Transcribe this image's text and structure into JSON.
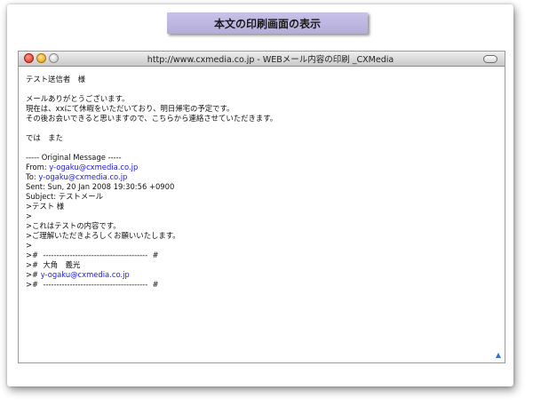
{
  "banner": {
    "title": "本文の印刷画面の表示"
  },
  "window": {
    "title": "http://www.cxmedia.co.jp - WEBメール内容の印刷 _CXMedia"
  },
  "email": {
    "greeting": "テスト送信者　様",
    "body_1": "メールありがとうございます。",
    "body_2": "現在は、xxにて休暇をいただいており、明日帰宅の予定です。",
    "body_3": "その後お会いできると思いますので、こちらから連絡させていただきます。",
    "closing": "では　また",
    "original_header": "----- Original Message -----",
    "from_label": "From: ",
    "from_addr": "y-ogaku@cxmedia.co.jp",
    "to_label": "To: ",
    "to_addr": "y-ogaku@cxmedia.co.jp",
    "sent": "Sent: Sun, 20 Jan 2008 19:30:56 +0900",
    "subject": "Subject: テストメール",
    "q1": ">テスト 様",
    "q2": ">",
    "q3": ">これはテストの内容です。",
    "q4": ">ご理解いただきよろしくお願いいたします。",
    "q5": ">",
    "sig_top": ">#  ---------------------------------------  #",
    "sig_name": ">#  大角　義光",
    "sig_prefix": "># ",
    "sig_email": "y-ogaku@cxmedia.co.jp",
    "sig_bottom": ">#  ---------------------------------------  #"
  },
  "icons": {
    "close": "close-icon",
    "minimize": "minimize-icon",
    "zoom": "zoom-icon",
    "toolbar_toggle": "toolbar-toggle-icon",
    "resize": "resize-grip-icon"
  }
}
